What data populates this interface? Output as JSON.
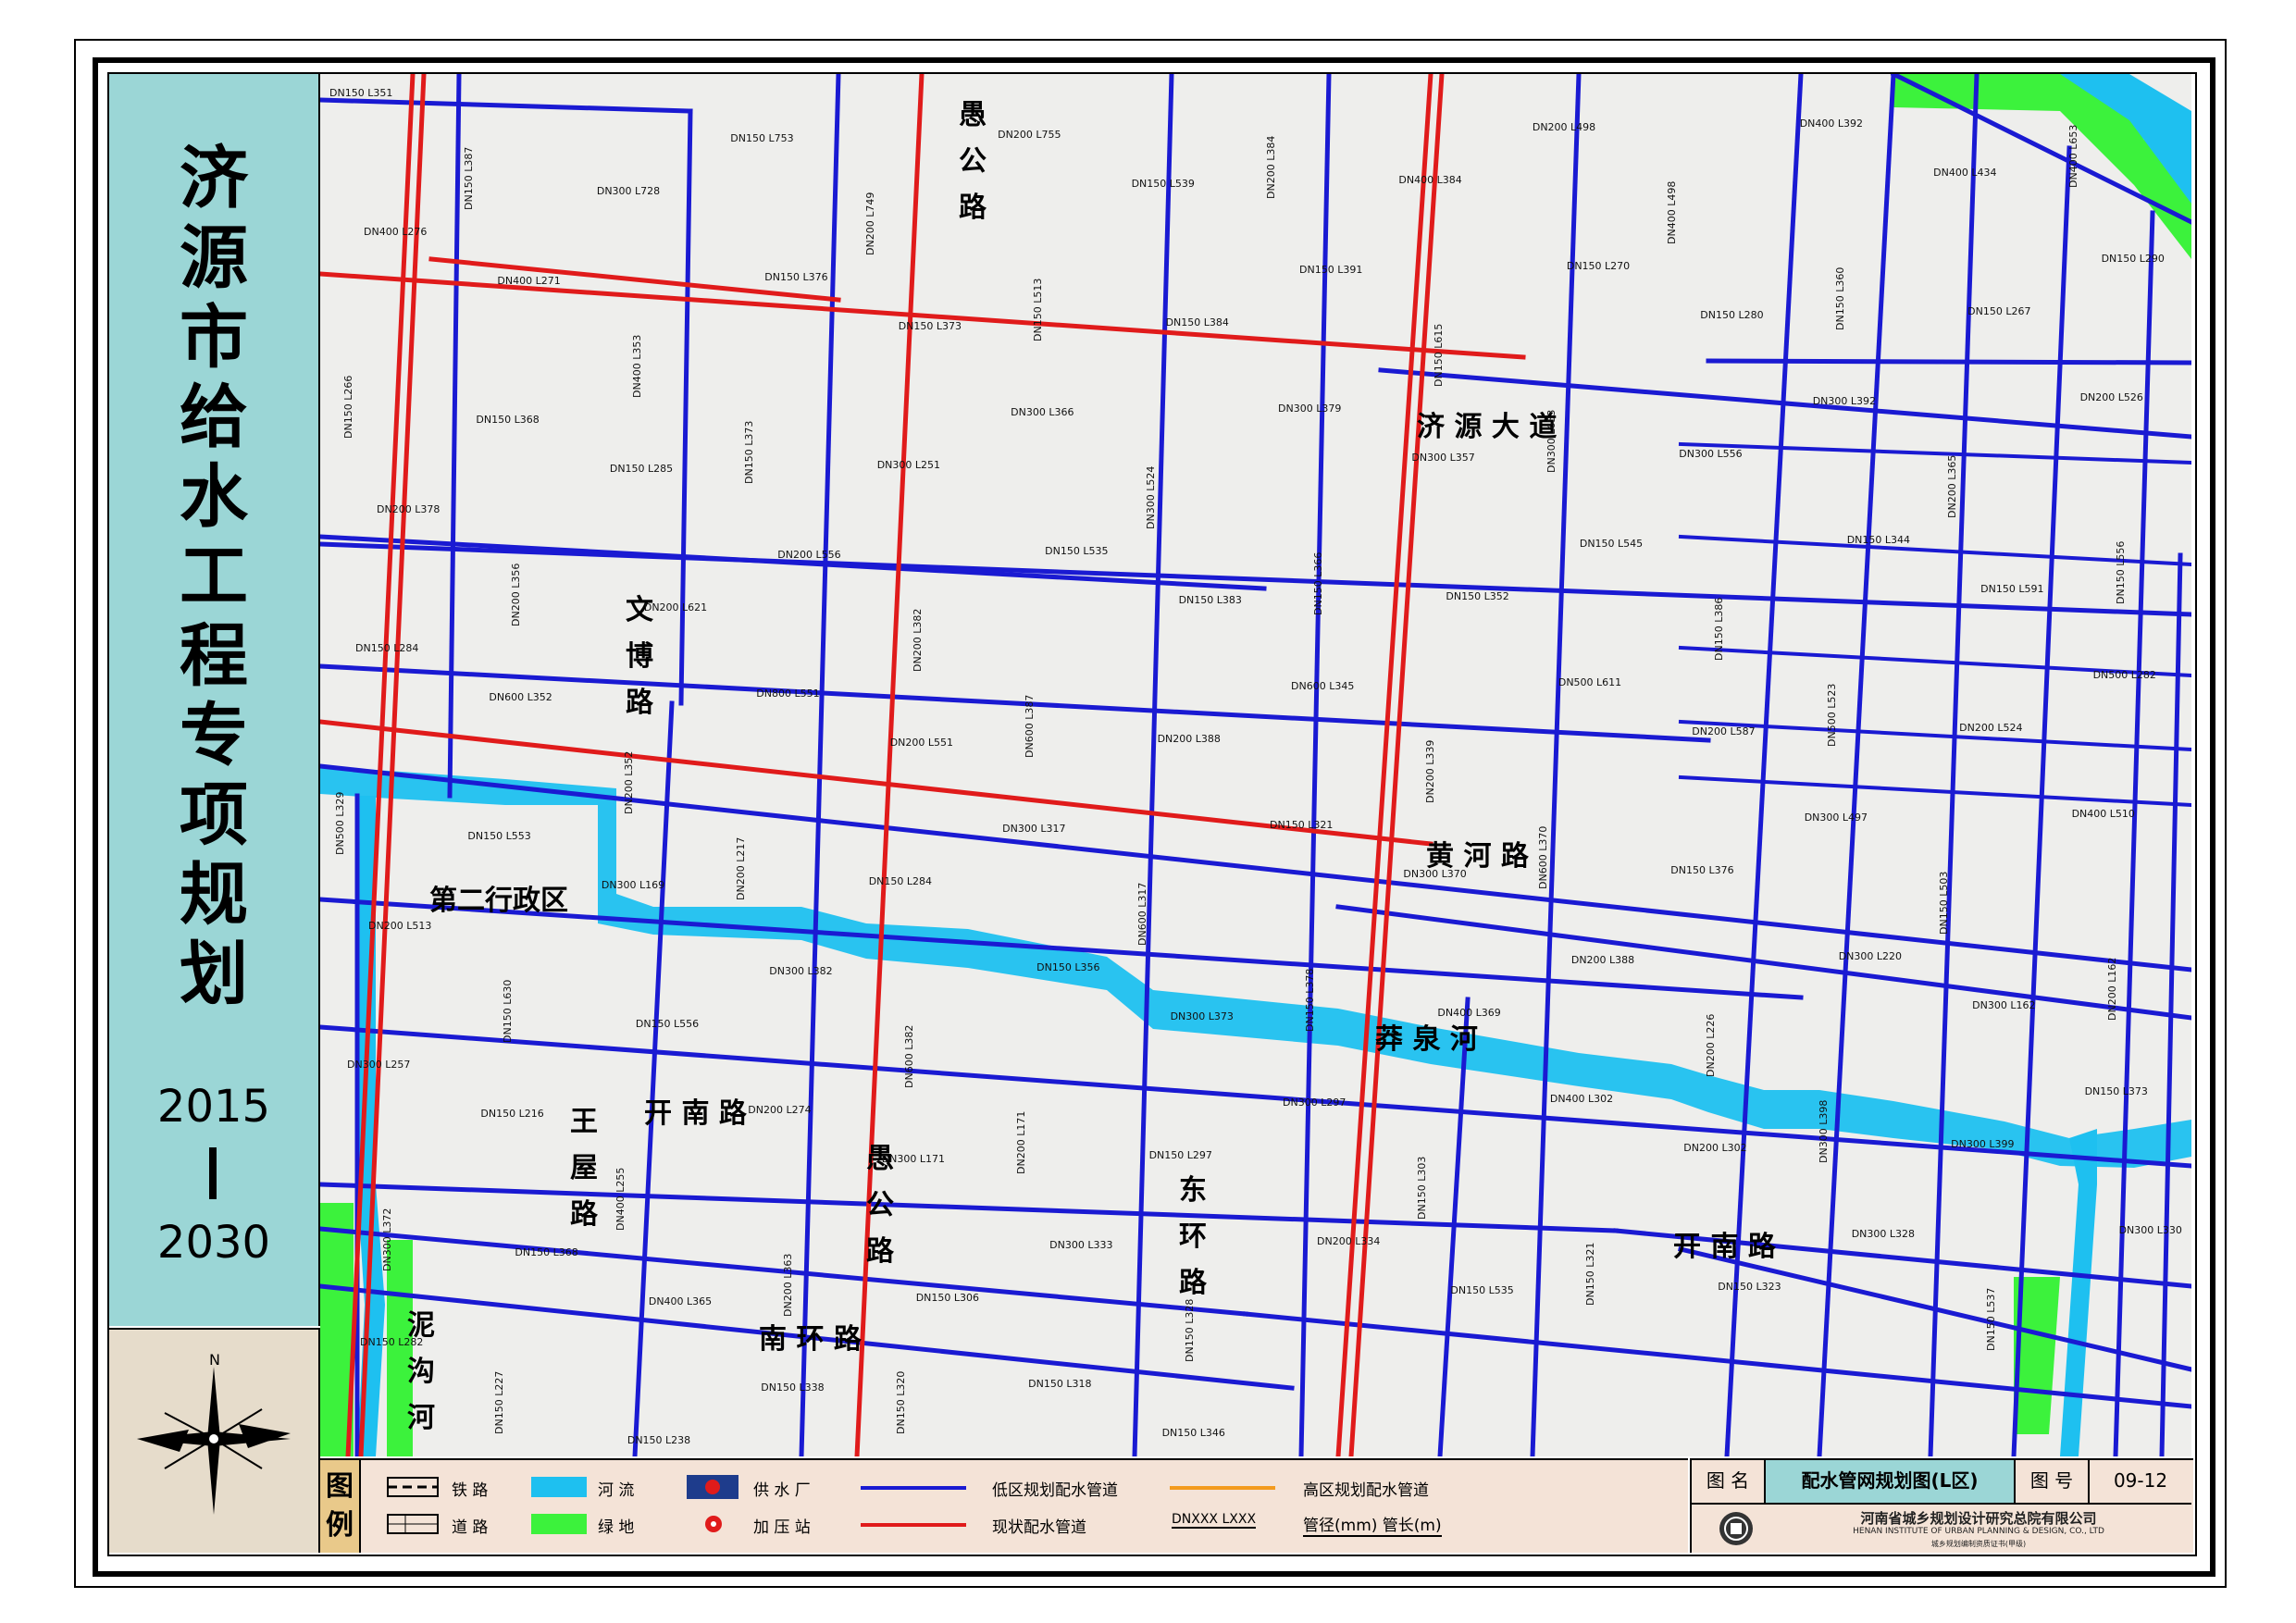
{
  "title": {
    "chars": [
      "济",
      "源",
      "市",
      "给",
      "水",
      "工",
      "程",
      "专",
      "项",
      "规",
      "划"
    ],
    "year_start": "2015",
    "year_end": "2030"
  },
  "compass": {
    "north": "N"
  },
  "map_labels": {
    "road_yugong_n": "愚\n公\n路",
    "road_jiyuan_dadao": "济 源 大 道",
    "road_wenbo": "文\n博\n路",
    "road_huanghe": "黄 河 路",
    "district_second_admin": "第二行政区",
    "river_mangquan": "莽 泉 河",
    "road_kainan_w": "开 南 路",
    "road_wangwu": "王\n屋\n路",
    "road_yugong_s": "愚\n公\n路",
    "road_donghuan": "东\n环\n路",
    "road_kainan_e": "开 南 路",
    "road_nanhuan": "南 环 路",
    "river_nigou": "泥\n沟\n河"
  },
  "pipe_annotations": [
    "DN150 L351",
    "DN150 L387",
    "DN300 L728",
    "DN150 L753",
    "DN200 L749",
    "DN200 L755",
    "DN150 L539",
    "DN200 L384",
    "DN400 L384",
    "DN200 L498",
    "DN400 L498",
    "DN400 L392",
    "DN400 L434",
    "DN400 L653",
    "DN400 L276",
    "DN400 L271",
    "DN400 L353",
    "DN150 L376",
    "DN150 L373",
    "DN150 L513",
    "DN150 L384",
    "DN150 L391",
    "DN150 L615",
    "DN150 L270",
    "DN150 L280",
    "DN150 L360",
    "DN150 L267",
    "DN150 L290",
    "DN150 L266",
    "DN150 L368",
    "DN150 L285",
    "DN150 L373",
    "DN300 L251",
    "DN300 L366",
    "DN300 L524",
    "DN300 L379",
    "DN300 L357",
    "DN300 L653",
    "DN300 L556",
    "DN300 L392",
    "DN200 L365",
    "DN200 L526",
    "DN200 L378",
    "DN200 L356",
    "DN200 L621",
    "DN200 L556",
    "DN200 L382",
    "DN150 L535",
    "DN150 L383",
    "DN150 L366",
    "DN150 L352",
    "DN150 L545",
    "DN150 L386",
    "DN150 L344",
    "DN150 L591",
    "DN150 L556",
    "DN150 L284",
    "DN600 L352",
    "DN200 L352",
    "DN800 L551",
    "DN200 L551",
    "DN600 L387",
    "DN200 L388",
    "DN600 L345",
    "DN200 L339",
    "DN500 L611",
    "DN200 L587",
    "DN500 L523",
    "DN200 L524",
    "DN500 L282",
    "DN500 L329",
    "DN150 L553",
    "DN300 L169",
    "DN200 L217",
    "DN150 L284",
    "DN300 L317",
    "DN600 L317",
    "DN150 L321",
    "DN300 L370",
    "DN600 L370",
    "DN150 L376",
    "DN300 L497",
    "DN150 L503",
    "DN400 L510",
    "DN200 L513",
    "DN150 L630",
    "DN150 L556",
    "DN300 L382",
    "DN600 L382",
    "DN150 L356",
    "DN300 L373",
    "DN150 L378",
    "DN400 L369",
    "DN200 L388",
    "DN200 L226",
    "DN300 L220",
    "DN300 L162",
    "DN200 L162",
    "DN300 L257",
    "DN150 L216",
    "DN400 L255",
    "DN200 L274",
    "DN300 L171",
    "DN200 L171",
    "DN150 L297",
    "DN300 L297",
    "DN150 L303",
    "DN400 L302",
    "DN200 L302",
    "DN300 L398",
    "DN300 L399",
    "DN150 L373",
    "DN300 L372",
    "DN150 L368",
    "DN400 L365",
    "DN200 L363",
    "DN150 L306",
    "DN300 L333",
    "DN150 L328",
    "DN200 L334",
    "DN150 L535",
    "DN150 L321",
    "DN150 L323",
    "DN300 L328",
    "DN150 L537",
    "DN300 L330",
    "DN150 L282",
    "DN150 L227",
    "DN150 L238",
    "DN150 L338",
    "DN150 L320",
    "DN150 L318",
    "DN150 L346"
  ],
  "legend": {
    "title": "图例",
    "railway": "铁  路",
    "road": "道  路",
    "river": "河  流",
    "greenland": "绿  地",
    "water_plant": "供 水 厂",
    "booster": "加 压 站",
    "low_zone_pipe": "低区规划配水管道",
    "existing_pipe": "现状配水管道",
    "high_zone_pipe": "高区规划配水管道",
    "dn_sample": "DNXXX    LXXX",
    "dn_explain": "管径(mm)  管长(m)"
  },
  "info": {
    "name_label": "图 名",
    "name_value": "配水管网规划图(L区)",
    "number_label": "图 号",
    "number_value": "09-12",
    "org_cn": "河南省城乡规划设计研究总院有限公司",
    "org_en": "HENAN INSTITUTE OF URBAN PLANNING & DESIGN, CO., LTD",
    "org_cert": "城乡规划编制资质证书(甲级)"
  },
  "colors": {
    "low_zone_pipe": "#1a1ad2",
    "existing_pipe": "#e01b1b",
    "high_zone_pipe": "#f39b1e",
    "river": "#1ec0f0",
    "greenland": "#3cf23c",
    "title_bg": "#9bd6d6",
    "map_bg": "#eeeeec"
  }
}
